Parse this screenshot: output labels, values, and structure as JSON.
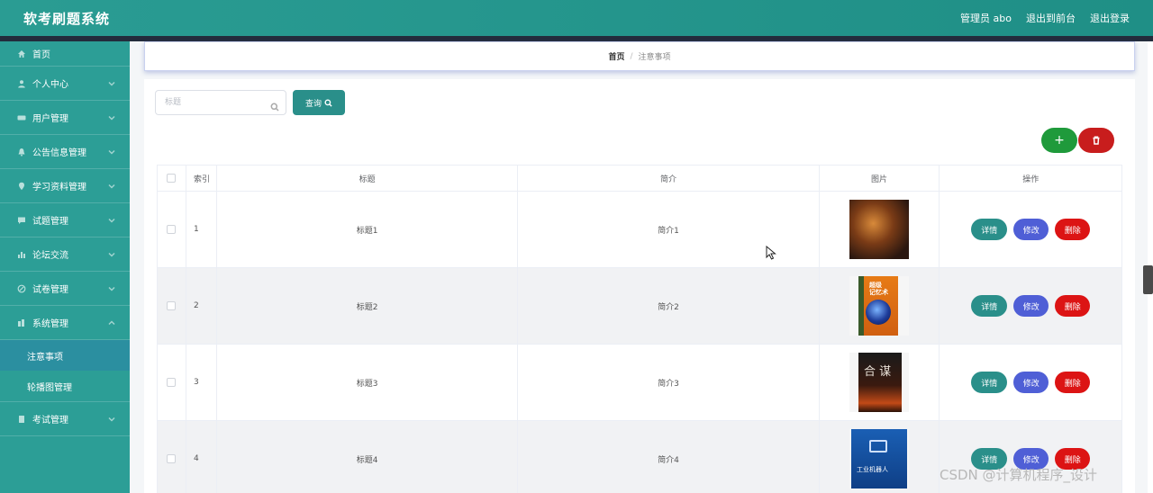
{
  "app": {
    "title": "软考刷题系统",
    "admin_label": "管理员 abo",
    "back_to_front": "退出到前台",
    "logout": "退出登录"
  },
  "sidebar": {
    "items": [
      {
        "label": "首页",
        "icon": "home-icon"
      },
      {
        "label": "个人中心",
        "icon": "user-icon"
      },
      {
        "label": "用户管理",
        "icon": "users-icon"
      },
      {
        "label": "公告信息管理",
        "icon": "bell-icon"
      },
      {
        "label": "学习资料管理",
        "icon": "pin-icon"
      },
      {
        "label": "试题管理",
        "icon": "chat-icon"
      },
      {
        "label": "论坛交流",
        "icon": "chart-icon"
      },
      {
        "label": "试卷管理",
        "icon": "circle-icon"
      },
      {
        "label": "系统管理",
        "icon": "cog-icon"
      },
      {
        "label": "考试管理",
        "icon": "doc-icon"
      }
    ],
    "sub_items": [
      {
        "label": "注意事项",
        "active": true
      },
      {
        "label": "轮播图管理",
        "active": false
      }
    ]
  },
  "breadcrumb": {
    "home": "首页",
    "separator": "/",
    "current": "注意事项"
  },
  "search": {
    "placeholder": "标题",
    "button_label": "查询"
  },
  "actions": {
    "add_label": "+"
  },
  "table": {
    "headers": [
      "索引",
      "标题",
      "简介",
      "图片",
      "操作"
    ],
    "rows": [
      {
        "index": "1",
        "title": "标题1",
        "intro": "简介1"
      },
      {
        "index": "2",
        "title": "标题2",
        "intro": "简介2"
      },
      {
        "index": "3",
        "title": "标题3",
        "intro": "简介3"
      },
      {
        "index": "4",
        "title": "标题4",
        "intro": "简介4"
      }
    ],
    "op_labels": {
      "detail": "详情",
      "edit": "修改",
      "delete": "删除"
    }
  },
  "covers": {
    "cover2_text": "超级\n记忆术",
    "cover3_text": "合 谋",
    "cover4_text": "工业机器人"
  },
  "watermark": "CSDN @计算机程序_设计",
  "colors": {
    "accent": "#2a8f8a",
    "edit": "#4f5fd6",
    "delete": "#dc1414",
    "add": "#1f9a3b"
  }
}
